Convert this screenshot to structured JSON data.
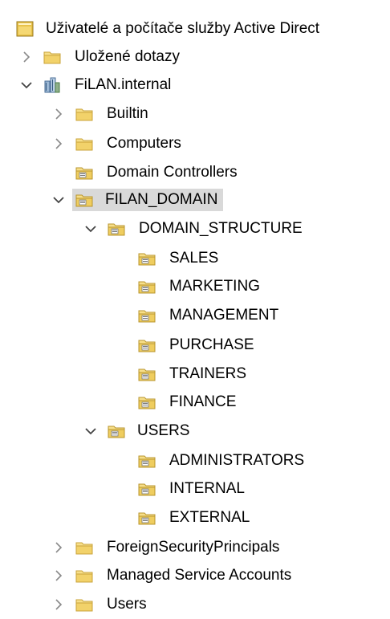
{
  "tree": {
    "root": {
      "label": "Uživatelé a počítače služby Active Direct",
      "icon": "ad-console-icon"
    },
    "saved_queries": {
      "label": "Uložené dotazy",
      "icon": "folder-icon"
    },
    "domain": {
      "label": "FiLAN.internal",
      "icon": "domain-icon"
    },
    "builtin": {
      "label": "Builtin",
      "icon": "folder-icon"
    },
    "computers": {
      "label": "Computers",
      "icon": "folder-icon"
    },
    "domain_controllers": {
      "label": "Domain Controllers",
      "icon": "ou-icon"
    },
    "filan_domain": {
      "label": "FILAN_DOMAIN",
      "icon": "ou-icon",
      "selected": true
    },
    "domain_structure": {
      "label": "DOMAIN_STRUCTURE",
      "icon": "ou-icon"
    },
    "sales": {
      "label": "SALES",
      "icon": "ou-icon"
    },
    "marketing": {
      "label": "MARKETING",
      "icon": "ou-icon"
    },
    "management": {
      "label": "MANAGEMENT",
      "icon": "ou-icon"
    },
    "purchase": {
      "label": "PURCHASE",
      "icon": "ou-icon"
    },
    "trainers": {
      "label": "TRAINERS",
      "icon": "ou-icon"
    },
    "finance": {
      "label": "FINANCE",
      "icon": "ou-icon"
    },
    "users_ou": {
      "label": "USERS",
      "icon": "ou-icon"
    },
    "administrators": {
      "label": "ADMINISTRATORS",
      "icon": "ou-icon"
    },
    "internal": {
      "label": "INTERNAL",
      "icon": "ou-icon"
    },
    "external": {
      "label": "EXTERNAL",
      "icon": "ou-icon"
    },
    "foreign_security_principals": {
      "label": "ForeignSecurityPrincipals",
      "icon": "folder-icon"
    },
    "managed_service_accounts": {
      "label": "Managed Service Accounts",
      "icon": "folder-icon"
    },
    "users": {
      "label": "Users",
      "icon": "folder-icon"
    }
  },
  "colors": {
    "selection": "#d9d9d9",
    "folder": "#f2d675",
    "folder_dark": "#d9b54a",
    "chevron": "#6b6b6b"
  }
}
